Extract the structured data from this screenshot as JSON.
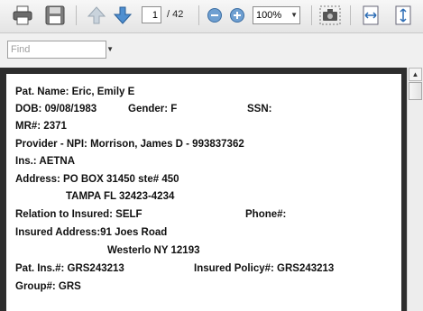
{
  "toolbar": {
    "current_page": "1",
    "page_total": "/ 42",
    "zoom": "100%"
  },
  "find": {
    "placeholder": "Find"
  },
  "doc": {
    "patient_name": "Pat. Name: Eric, Emily E",
    "dob": "DOB: 09/08/1983",
    "gender": "Gender: F",
    "ssn": "SSN:",
    "mr": "MR#:   2371",
    "provider": "Provider - NPI: Morrison, James D - 993837362",
    "ins": "Ins.: AETNA",
    "address_label": "Address: PO BOX 31450 ste# 450",
    "address_line2": "TAMPA FL 32423-4234",
    "relation": "Relation to Insured:  SELF",
    "phone": "Phone#:",
    "insured_address": "Insured Address:91 Joes Road",
    "insured_address2": "Westerlo NY 12193",
    "pat_ins": "Pat. Ins.#: GRS243213",
    "insured_policy": "Insured Policy#: GRS243213",
    "group": "Group#:  GRS"
  }
}
